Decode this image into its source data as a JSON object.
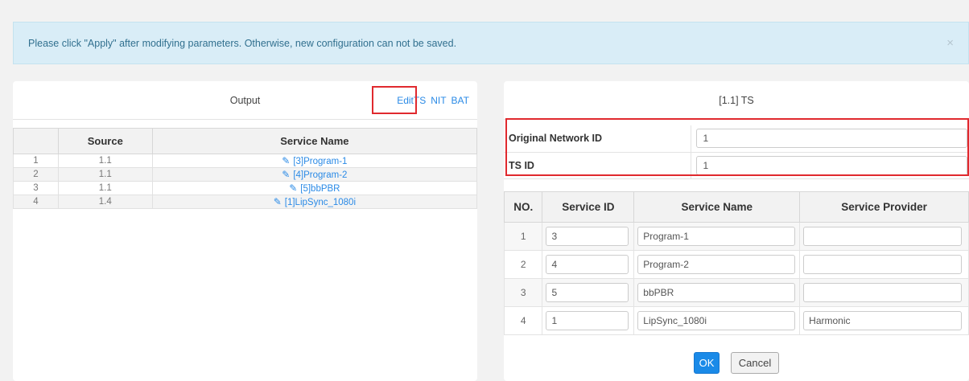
{
  "alert": {
    "message": "Please click \"Apply\" after modifying parameters. Otherwise, new configuration can not be saved.",
    "close_glyph": "×"
  },
  "output_panel": {
    "title": "Output",
    "links": {
      "edit_ts": "EditTS",
      "nit": "NIT",
      "bat": "BAT"
    },
    "columns": [
      "",
      "Source",
      "Service Name"
    ],
    "rows": [
      {
        "index": "1",
        "source": "1.1",
        "service_name": "[3]Program-1"
      },
      {
        "index": "2",
        "source": "1.1",
        "service_name": "[4]Program-2"
      },
      {
        "index": "3",
        "source": "1.1",
        "service_name": "[5]bbPBR"
      },
      {
        "index": "4",
        "source": "1.4",
        "service_name": "[1]LipSync_1080i"
      }
    ]
  },
  "ts_panel": {
    "title": "[1.1] TS",
    "original_network_id_label": "Original Network ID",
    "original_network_id_value": "1",
    "ts_id_label": "TS ID",
    "ts_id_value": "1",
    "columns": [
      "NO.",
      "Service ID",
      "Service Name",
      "Service Provider"
    ],
    "rows": [
      {
        "no": "1",
        "service_id": "3",
        "service_name": "Program-1",
        "service_provider": ""
      },
      {
        "no": "2",
        "service_id": "4",
        "service_name": "Program-2",
        "service_provider": ""
      },
      {
        "no": "3",
        "service_id": "5",
        "service_name": "bbPBR",
        "service_provider": ""
      },
      {
        "no": "4",
        "service_id": "1",
        "service_name": "LipSync_1080i",
        "service_provider": "Harmonic"
      }
    ],
    "ok_label": "OK",
    "cancel_label": "Cancel"
  },
  "colors": {
    "link": "#2a8ae6",
    "highlight": "#e0292e",
    "primary": "#1a8ae8",
    "alert_bg": "#d9edf7"
  },
  "icons": {
    "edit": "pencil-icon",
    "close": "close-icon"
  }
}
